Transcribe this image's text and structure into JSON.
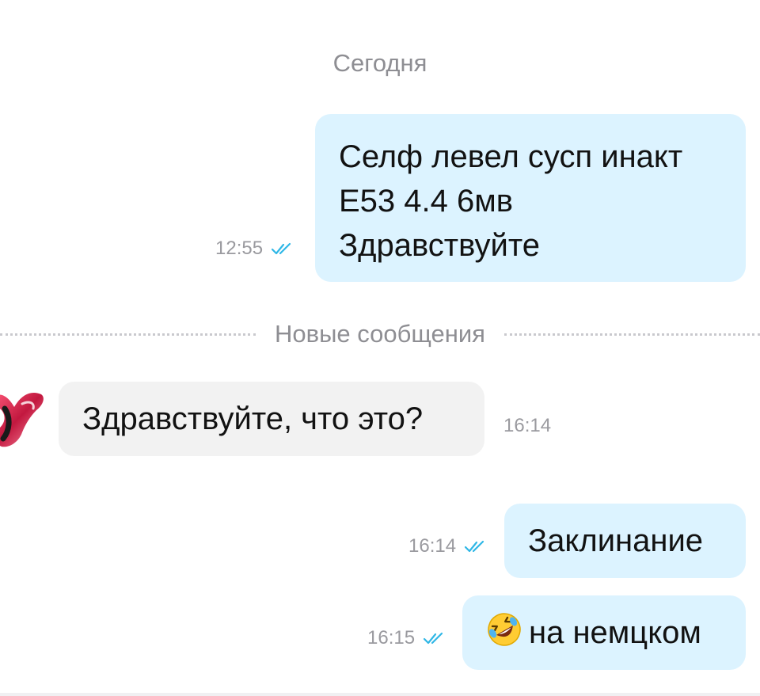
{
  "date_separator": "Сегодня",
  "new_messages_separator": "Новые сообщения",
  "messages": [
    {
      "direction": "out",
      "lines": [
        "Селф левел сусп инакт",
        "E53 4.4 6мв",
        "Здравствуйте"
      ],
      "time": "12:55",
      "status": "read"
    },
    {
      "direction": "in",
      "text": "Здравствуйте, что это?",
      "time": "16:14",
      "sender_avatar": "user-avatar"
    },
    {
      "direction": "out",
      "text": "Заклинание",
      "time": "16:14",
      "status": "read"
    },
    {
      "direction": "out",
      "emoji": "rolling-on-floor-laughing-emoji",
      "text": "на немцком",
      "time": "16:15",
      "status": "read"
    }
  ],
  "colors": {
    "outgoing_bubble": "#dcf3ff",
    "incoming_bubble": "#f2f2f2",
    "read_check": "#2fb7e6",
    "meta_text": "#9a9a9f"
  }
}
